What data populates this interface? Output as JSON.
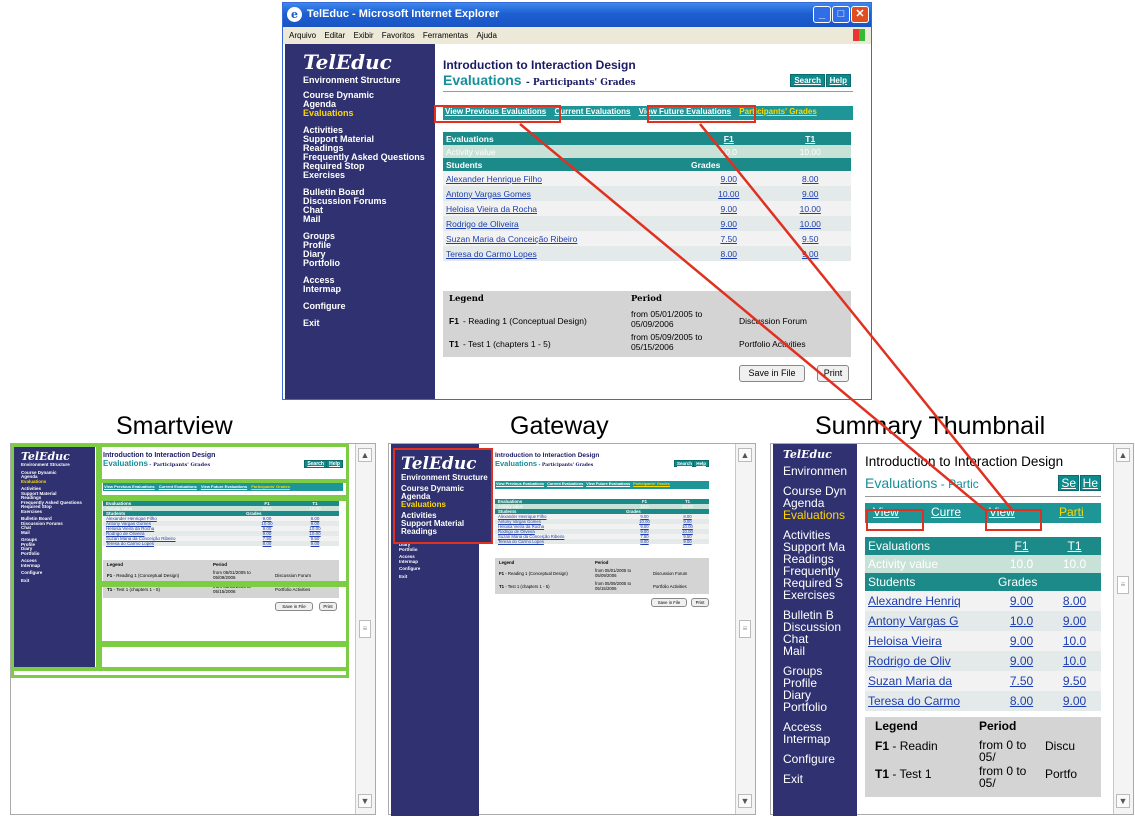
{
  "browser": {
    "title": "TelEduc - Microsoft Internet Explorer",
    "menu": [
      "Arquivo",
      "Editar",
      "Exibir",
      "Favoritos",
      "Ferramentas",
      "Ajuda"
    ]
  },
  "sidebar": {
    "logo": "TelEduc",
    "groups": [
      [
        "Environment Structure"
      ],
      [
        "Course Dynamic",
        "Agenda",
        "Evaluations"
      ],
      [
        "Activities",
        "Support Material",
        "Readings",
        "Frequently Asked Questions",
        "Required Stop",
        "Exercises"
      ],
      [
        "Bulletin Board",
        "Discussion Forums",
        "Chat",
        "Mail"
      ],
      [
        "Groups",
        "Profile",
        "Diary",
        "Portfolio"
      ],
      [
        "Access",
        "Intermap"
      ],
      [
        "Configure"
      ],
      [
        "Exit"
      ]
    ],
    "highlighted": "Evaluations"
  },
  "main": {
    "course_title": "Introduction to Interaction Design",
    "section": "Evaluations",
    "subsection": "- Participants' Grades",
    "search_label": "Search",
    "help_label": "Help",
    "tabs": [
      "View Previous Evaluations",
      "Current Evaluations",
      "View Future Evaluations",
      "Participants' Grades"
    ],
    "table": {
      "col_eval": "Evaluations",
      "f1": "F1",
      "t1": "T1",
      "activity_label": "Activity value",
      "activity_f1": "10.0",
      "activity_t1": "10.00",
      "students_label": "Students",
      "grades_label": "Grades",
      "rows": [
        {
          "name": "Alexander Henrique Filho",
          "f1": "9.00",
          "t1": "8.00"
        },
        {
          "name": "Antony Vargas Gomes",
          "f1": "10.00",
          "t1": "9.00"
        },
        {
          "name": "Heloisa Vieira da Rocha",
          "f1": "9.00",
          "t1": "10.00"
        },
        {
          "name": "Rodrigo de Oliveira",
          "f1": "9.00",
          "t1": "10.00"
        },
        {
          "name": "Suzan Maria da Conceição Ribeiro",
          "f1": "7.50",
          "t1": "9.50"
        },
        {
          "name": "Teresa do Carmo Lopes",
          "f1": "8.00",
          "t1": "9.00"
        }
      ]
    },
    "legend": {
      "legend_label": "Legend",
      "period_label": "Period",
      "f1_code": "F1",
      "f1_text": "- Reading 1 (Conceptual Design)",
      "f1_period": "from 05/01/2005 to 05/09/2006",
      "f1_tool": "Discussion Forum",
      "t1_code": "T1",
      "t1_text": "- Test 1 (chapters 1 - 5)",
      "t1_period": "from 05/09/2005 to 05/15/2006",
      "t1_tool": "Portfolio Activities"
    },
    "save_label": "Save in File",
    "print_label": "Print"
  },
  "labels": {
    "smartview": "Smartview",
    "gateway": "Gateway",
    "thumbnail": "Summary Thumbnail"
  },
  "thumbnail": {
    "sidebar": [
      "Environmen",
      "Course Dyn",
      "Agenda",
      "Evaluations",
      "Activities",
      "Support Ma",
      "Readings",
      "Frequently",
      "Required S",
      "Exercises",
      "Bulletin B",
      "Discussion",
      "Chat",
      "Mail",
      "Groups",
      "Profile",
      "Diary",
      "Portfolio",
      "Access",
      "Intermap",
      "Configure",
      "Exit"
    ],
    "title": "Introduction to Interaction Design",
    "section": "Evaluations",
    "subsection": "- Partic",
    "search": "Se",
    "help": "He",
    "tabs": [
      "View",
      "Curre",
      "View",
      "Parti"
    ],
    "eval_label": "Evaluations",
    "f1": "F1",
    "t1": "T1",
    "activity_label": "Activity value",
    "activity_f1": "10.0",
    "activity_t1": "10.0",
    "students_label": "Students",
    "grades_label": "Grades",
    "rows": [
      {
        "name": "Alexandre Henriq",
        "f1": "9.00",
        "t1": "8.00"
      },
      {
        "name": "Antony Vargas G",
        "f1": "10.0",
        "t1": "9.00"
      },
      {
        "name": "Heloisa Vieira",
        "f1": "9.00",
        "t1": "10.0"
      },
      {
        "name": "Rodrigo de Oliv",
        "f1": "9.00",
        "t1": "10.0"
      },
      {
        "name": "Suzan Maria da",
        "f1": "7.50",
        "t1": "9.50"
      },
      {
        "name": "Teresa do Carmo",
        "f1": "8.00",
        "t1": "9.00"
      }
    ],
    "legend_label": "Legend",
    "period_label": "Period",
    "f1_code": "F1",
    "f1_text": "- Readin",
    "f1_period": "from 0 to 05/",
    "f1_tool": "Discu",
    "t1_code": "T1",
    "t1_text": "- Test 1",
    "t1_period": "from 0 to 05/",
    "t1_tool": "Portfo"
  },
  "gateway": {
    "sidebar_items": [
      "Environment Structure",
      "Course Dynamic",
      "Agenda",
      "Evaluations",
      "Activities",
      "Support Material",
      "Readings"
    ]
  },
  "colors": {
    "sidebar": "#2f3170",
    "teal": "#1d8a8a",
    "highlight": "#ffd800",
    "red_box": "#e03020",
    "green_box": "#7ccc44"
  }
}
